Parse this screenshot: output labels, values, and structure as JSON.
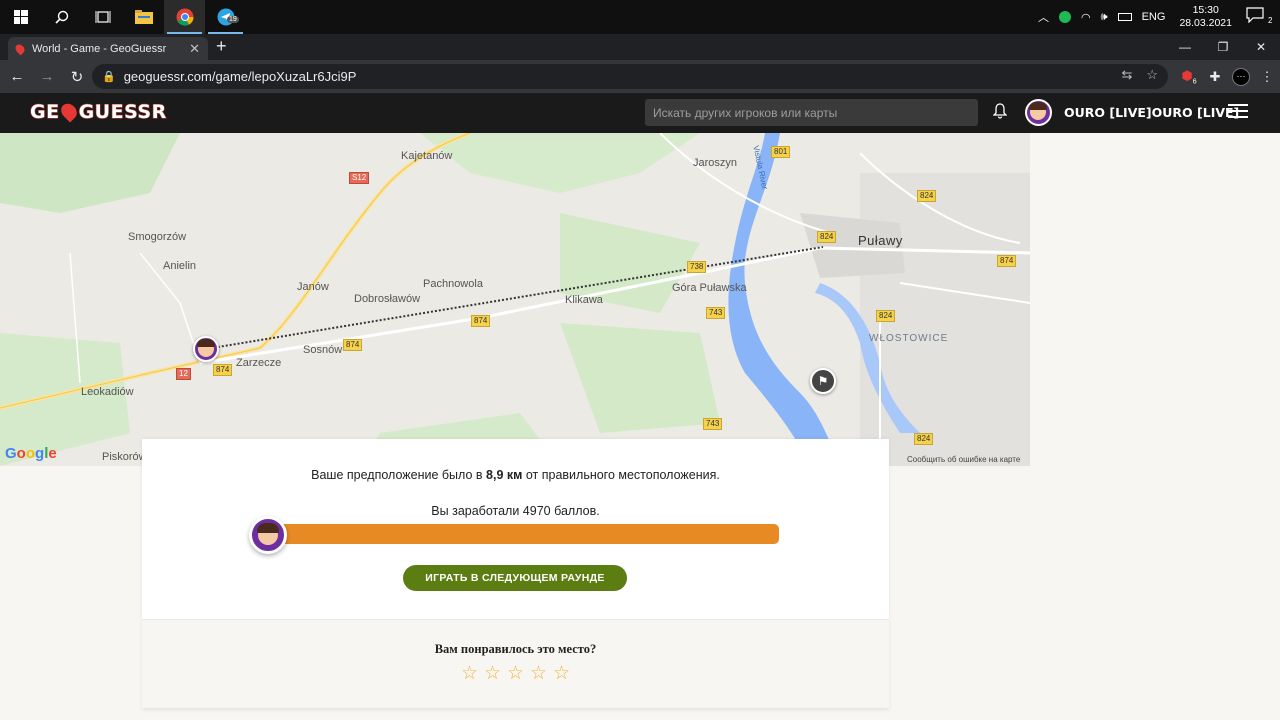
{
  "taskbar": {
    "apps": [
      "windows-start-icon",
      "search-icon",
      "task-view-icon",
      "file-explorer-icon",
      "chrome-icon",
      "telegram-icon"
    ],
    "telegram_badge": "19",
    "tray": {
      "language": "ENG",
      "time": "15:30",
      "date": "28.03.2021",
      "notifications": "2"
    }
  },
  "browser": {
    "tab_title": "World - Game - GeoGuessr",
    "url": "geoguessr.com/game/lepoXuzaLr6Jci9P",
    "extension_badge": "6"
  },
  "header": {
    "logo_left": "GE",
    "logo_right": "GUESSR",
    "search_placeholder": "Искать других игроков или карты",
    "user_name": "OURO [LIVE]OURO [LIVE]"
  },
  "map": {
    "labels": {
      "kajetanow": "Kajetanów",
      "jaroszyn": "Jaroszyn",
      "smogorzow": "Smogorzów",
      "anielin": "Anielin",
      "pulawy": "Puławy",
      "pachnowola": "Pachnowola",
      "janow": "Janów",
      "dobroslawow": "Dobrosławów",
      "klikawa": "Klikawa",
      "gora_pulawska": "Góra Puławska",
      "wlostowice": "WŁOSTOWICE",
      "zarzecze": "Zarzecze",
      "sosnow": "Sosnów",
      "leokadiow": "Leokadiów",
      "piskorow": "Piskorów",
      "vistula": "Vistula River"
    },
    "roads": {
      "s12": "S12",
      "r801": "801",
      "r824a": "824",
      "r824b": "824",
      "r824c": "824",
      "r824d": "824",
      "r738": "738",
      "r743a": "743",
      "r743b": "743",
      "r874a": "874",
      "r874b": "874",
      "r874c": "874",
      "r874d": "874",
      "r12": "12"
    },
    "google": "Google",
    "report": "Сообщить об ошибке на карте"
  },
  "result": {
    "guess_prefix": "Ваше предположение было в ",
    "distance": "8,9 км",
    "guess_suffix": " от правильного местоположения.",
    "score_text": "Вы заработали 4970 баллов.",
    "score_fraction": 0.994,
    "next_round": "ИГРАТЬ В СЛЕДУЮЩЕМ РАУНДЕ"
  },
  "rating": {
    "question": "Вам понравилось это место?",
    "stars": 5
  },
  "colors": {
    "accent_orange": "#e88a23",
    "button_green": "#5b7d12",
    "logo_red": "#e53935"
  }
}
